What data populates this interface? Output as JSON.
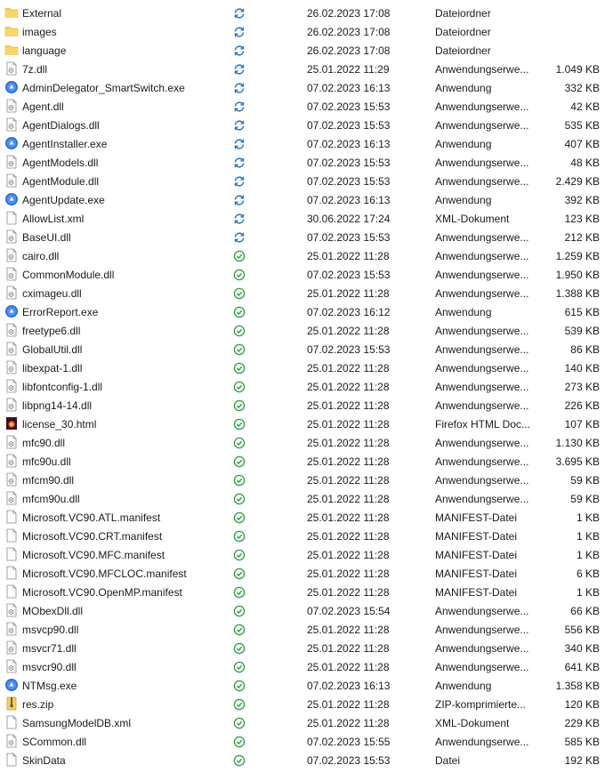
{
  "colors": {
    "folder": "#f6c94e",
    "sync_blue": "#1e73be",
    "synced_green": "#2a9d3c",
    "exe_blue": "#2d6fd0",
    "html_dark": "#3a1020"
  },
  "files": [
    {
      "name": "External",
      "icon": "folder-icon",
      "status": "sync-pending-icon",
      "date": "26.02.2023 17:08",
      "type": "Dateiordner",
      "size": ""
    },
    {
      "name": "images",
      "icon": "folder-icon",
      "status": "sync-pending-icon",
      "date": "26.02.2023 17:08",
      "type": "Dateiordner",
      "size": ""
    },
    {
      "name": "language",
      "icon": "folder-icon",
      "status": "sync-pending-icon",
      "date": "26.02.2023 17:08",
      "type": "Dateiordner",
      "size": ""
    },
    {
      "name": "7z.dll",
      "icon": "dll-icon",
      "status": "sync-pending-icon",
      "date": "25.01.2022 11:29",
      "type": "Anwendungserwe...",
      "size": "1.049 KB"
    },
    {
      "name": "AdminDelegator_SmartSwitch.exe",
      "icon": "exe-icon",
      "status": "sync-pending-icon",
      "date": "07.02.2023 16:13",
      "type": "Anwendung",
      "size": "332 KB"
    },
    {
      "name": "Agent.dll",
      "icon": "dll-icon",
      "status": "sync-pending-icon",
      "date": "07.02.2023 15:53",
      "type": "Anwendungserwe...",
      "size": "42 KB"
    },
    {
      "name": "AgentDialogs.dll",
      "icon": "dll-icon",
      "status": "sync-pending-icon",
      "date": "07.02.2023 15:53",
      "type": "Anwendungserwe...",
      "size": "535 KB"
    },
    {
      "name": "AgentInstaller.exe",
      "icon": "exe-icon",
      "status": "sync-pending-icon",
      "date": "07.02.2023 16:13",
      "type": "Anwendung",
      "size": "407 KB"
    },
    {
      "name": "AgentModels.dll",
      "icon": "dll-icon",
      "status": "sync-pending-icon",
      "date": "07.02.2023 15:53",
      "type": "Anwendungserwe...",
      "size": "48 KB"
    },
    {
      "name": "AgentModule.dll",
      "icon": "dll-icon",
      "status": "sync-pending-icon",
      "date": "07.02.2023 15:53",
      "type": "Anwendungserwe...",
      "size": "2.429 KB"
    },
    {
      "name": "AgentUpdate.exe",
      "icon": "exe-icon",
      "status": "sync-pending-icon",
      "date": "07.02.2023 16:13",
      "type": "Anwendung",
      "size": "392 KB"
    },
    {
      "name": "AllowList.xml",
      "icon": "file-icon",
      "status": "sync-pending-icon",
      "date": "30.06.2022 17:24",
      "type": "XML-Dokument",
      "size": "123 KB"
    },
    {
      "name": "BaseUI.dll",
      "icon": "dll-icon",
      "status": "sync-pending-icon",
      "date": "07.02.2023 15:53",
      "type": "Anwendungserwe...",
      "size": "212 KB"
    },
    {
      "name": "cairo.dll",
      "icon": "dll-icon",
      "status": "synced-check-icon",
      "date": "25.01.2022 11:28",
      "type": "Anwendungserwe...",
      "size": "1.259 KB"
    },
    {
      "name": "CommonModule.dll",
      "icon": "dll-icon",
      "status": "synced-check-icon",
      "date": "07.02.2023 15:53",
      "type": "Anwendungserwe...",
      "size": "1.950 KB"
    },
    {
      "name": "cximageu.dll",
      "icon": "dll-icon",
      "status": "synced-check-icon",
      "date": "25.01.2022 11:28",
      "type": "Anwendungserwe...",
      "size": "1.388 KB"
    },
    {
      "name": "ErrorReport.exe",
      "icon": "exe-icon",
      "status": "synced-check-icon",
      "date": "07.02.2023 16:12",
      "type": "Anwendung",
      "size": "615 KB"
    },
    {
      "name": "freetype6.dll",
      "icon": "dll-icon",
      "status": "synced-check-icon",
      "date": "25.01.2022 11:28",
      "type": "Anwendungserwe...",
      "size": "539 KB"
    },
    {
      "name": "GlobalUtil.dll",
      "icon": "dll-icon",
      "status": "synced-check-icon",
      "date": "07.02.2023 15:53",
      "type": "Anwendungserwe...",
      "size": "86 KB"
    },
    {
      "name": "libexpat-1.dll",
      "icon": "dll-icon",
      "status": "synced-check-icon",
      "date": "25.01.2022 11:28",
      "type": "Anwendungserwe...",
      "size": "140 KB"
    },
    {
      "name": "libfontconfig-1.dll",
      "icon": "dll-icon",
      "status": "synced-check-icon",
      "date": "25.01.2022 11:28",
      "type": "Anwendungserwe...",
      "size": "273 KB"
    },
    {
      "name": "libpng14-14.dll",
      "icon": "dll-icon",
      "status": "synced-check-icon",
      "date": "25.01.2022 11:28",
      "type": "Anwendungserwe...",
      "size": "226 KB"
    },
    {
      "name": "license_30.html",
      "icon": "html-icon",
      "status": "synced-check-icon",
      "date": "25.01.2022 11:28",
      "type": "Firefox HTML Doc...",
      "size": "107 KB"
    },
    {
      "name": "mfc90.dll",
      "icon": "dll-icon",
      "status": "synced-check-icon",
      "date": "25.01.2022 11:28",
      "type": "Anwendungserwe...",
      "size": "1.130 KB"
    },
    {
      "name": "mfc90u.dll",
      "icon": "dll-icon",
      "status": "synced-check-icon",
      "date": "25.01.2022 11:28",
      "type": "Anwendungserwe...",
      "size": "3.695 KB"
    },
    {
      "name": "mfcm90.dll",
      "icon": "dll-icon",
      "status": "synced-check-icon",
      "date": "25.01.2022 11:28",
      "type": "Anwendungserwe...",
      "size": "59 KB"
    },
    {
      "name": "mfcm90u.dll",
      "icon": "dll-icon",
      "status": "synced-check-icon",
      "date": "25.01.2022 11:28",
      "type": "Anwendungserwe...",
      "size": "59 KB"
    },
    {
      "name": "Microsoft.VC90.ATL.manifest",
      "icon": "file-icon",
      "status": "synced-check-icon",
      "date": "25.01.2022 11:28",
      "type": "MANIFEST-Datei",
      "size": "1 KB"
    },
    {
      "name": "Microsoft.VC90.CRT.manifest",
      "icon": "file-icon",
      "status": "synced-check-icon",
      "date": "25.01.2022 11:28",
      "type": "MANIFEST-Datei",
      "size": "1 KB"
    },
    {
      "name": "Microsoft.VC90.MFC.manifest",
      "icon": "file-icon",
      "status": "synced-check-icon",
      "date": "25.01.2022 11:28",
      "type": "MANIFEST-Datei",
      "size": "1 KB"
    },
    {
      "name": "Microsoft.VC90.MFCLOC.manifest",
      "icon": "file-icon",
      "status": "synced-check-icon",
      "date": "25.01.2022 11:28",
      "type": "MANIFEST-Datei",
      "size": "6 KB"
    },
    {
      "name": "Microsoft.VC90.OpenMP.manifest",
      "icon": "file-icon",
      "status": "synced-check-icon",
      "date": "25.01.2022 11:28",
      "type": "MANIFEST-Datei",
      "size": "1 KB"
    },
    {
      "name": "MObexDll.dll",
      "icon": "dll-icon",
      "status": "synced-check-icon",
      "date": "07.02.2023 15:54",
      "type": "Anwendungserwe...",
      "size": "66 KB"
    },
    {
      "name": "msvcp90.dll",
      "icon": "dll-icon",
      "status": "synced-check-icon",
      "date": "25.01.2022 11:28",
      "type": "Anwendungserwe...",
      "size": "556 KB"
    },
    {
      "name": "msvcr71.dll",
      "icon": "dll-icon",
      "status": "synced-check-icon",
      "date": "25.01.2022 11:28",
      "type": "Anwendungserwe...",
      "size": "340 KB"
    },
    {
      "name": "msvcr90.dll",
      "icon": "dll-icon",
      "status": "synced-check-icon",
      "date": "25.01.2022 11:28",
      "type": "Anwendungserwe...",
      "size": "641 KB"
    },
    {
      "name": "NTMsg.exe",
      "icon": "exe-icon",
      "status": "synced-check-icon",
      "date": "07.02.2023 16:13",
      "type": "Anwendung",
      "size": "1.358 KB"
    },
    {
      "name": "res.zip",
      "icon": "zip-icon",
      "status": "synced-check-icon",
      "date": "25.01.2022 11:28",
      "type": "ZIP-komprimierte...",
      "size": "120 KB"
    },
    {
      "name": "SamsungModelDB.xml",
      "icon": "file-icon",
      "status": "synced-check-icon",
      "date": "25.01.2022 11:28",
      "type": "XML-Dokument",
      "size": "229 KB"
    },
    {
      "name": "SCommon.dll",
      "icon": "dll-icon",
      "status": "synced-check-icon",
      "date": "07.02.2023 15:55",
      "type": "Anwendungserwe...",
      "size": "585 KB"
    },
    {
      "name": "SkinData",
      "icon": "file-icon",
      "status": "synced-check-icon",
      "date": "07.02.2023 15:53",
      "type": "Datei",
      "size": "192 KB"
    }
  ]
}
